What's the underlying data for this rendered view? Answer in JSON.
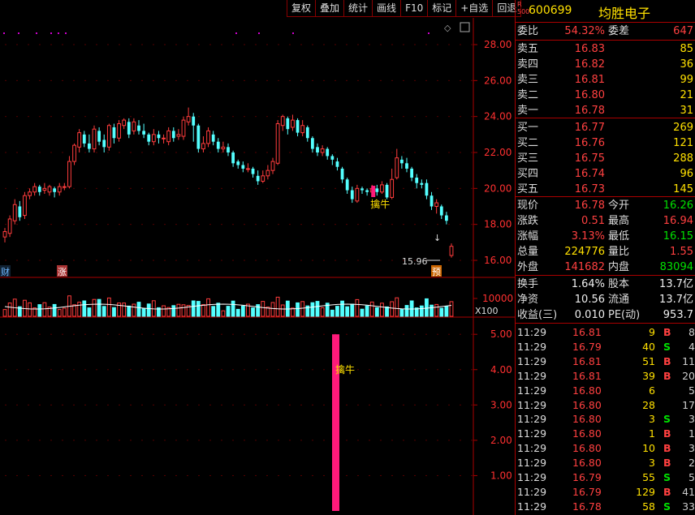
{
  "toolbar": {
    "buttons": [
      "复权",
      "叠加",
      "统计",
      "画线",
      "F10",
      "标记",
      "+自选",
      "回退"
    ]
  },
  "main_chart": {
    "y_ticks": [
      "28.00",
      "26.00",
      "24.00",
      "22.00",
      "20.00",
      "18.00",
      "16.00"
    ],
    "low_annotation": "15.96",
    "signal_label": "擒牛",
    "markers": {
      "cai": "财",
      "zhang": "涨",
      "yu": "预"
    }
  },
  "volume_chart": {
    "y_tick": "10000",
    "unit": "X100"
  },
  "indicator_chart": {
    "y_ticks": [
      "5.00",
      "4.00",
      "3.00",
      "2.00",
      "1.00"
    ],
    "signal_label": "擒牛",
    "bar_value": 5.0
  },
  "colors": {
    "up": "#ff3c3c",
    "down": "#54ffff",
    "signal_bar": "#ff1a7a",
    "axis": "#aa0000"
  },
  "stock": {
    "badge_top": "R",
    "badge_bottom": "500",
    "code": "600699",
    "name": "均胜电子"
  },
  "order_ratio": {
    "label": "委比",
    "value": "54.32%",
    "label2": "委差",
    "value2": "647"
  },
  "asks": [
    {
      "label": "卖五",
      "price": "16.83",
      "vol": "85"
    },
    {
      "label": "卖四",
      "price": "16.82",
      "vol": "36"
    },
    {
      "label": "卖三",
      "price": "16.81",
      "vol": "99"
    },
    {
      "label": "卖二",
      "price": "16.80",
      "vol": "21"
    },
    {
      "label": "卖一",
      "price": "16.78",
      "vol": "31"
    }
  ],
  "bids": [
    {
      "label": "买一",
      "price": "16.77",
      "vol": "269"
    },
    {
      "label": "买二",
      "price": "16.76",
      "vol": "121"
    },
    {
      "label": "买三",
      "price": "16.75",
      "vol": "288"
    },
    {
      "label": "买四",
      "price": "16.74",
      "vol": "96"
    },
    {
      "label": "买五",
      "price": "16.73",
      "vol": "145"
    }
  ],
  "quote": [
    {
      "l1": "现价",
      "v1": "16.78",
      "c1": "red",
      "l2": "今开",
      "v2": "16.26",
      "c2": "green"
    },
    {
      "l1": "涨跌",
      "v1": "0.51",
      "c1": "red",
      "l2": "最高",
      "v2": "16.94",
      "c2": "red"
    },
    {
      "l1": "涨幅",
      "v1": "3.13%",
      "c1": "red",
      "l2": "最低",
      "v2": "16.15",
      "c2": "green"
    },
    {
      "l1": "总量",
      "v1": "224776",
      "c1": "yellow",
      "l2": "量比",
      "v2": "1.55",
      "c2": "red"
    },
    {
      "l1": "外盘",
      "v1": "141682",
      "c1": "red",
      "l2": "内盘",
      "v2": "83094",
      "c2": "green"
    }
  ],
  "fundamentals": [
    {
      "l1": "换手",
      "v1": "1.64%",
      "l2": "股本",
      "v2": "13.7亿"
    },
    {
      "l1": "净资",
      "v1": "10.56",
      "l2": "流通",
      "v2": "13.7亿"
    },
    {
      "l1": "收益(三)",
      "v1": "0.010",
      "l2": "PE(动)",
      "v2": "953.7"
    }
  ],
  "trades": [
    {
      "time": "11:29",
      "price": "16.81",
      "pc": "red",
      "vol": "9",
      "vc": "yellow",
      "side": "B",
      "sc": "red",
      "cnt": "8"
    },
    {
      "time": "11:29",
      "price": "16.79",
      "pc": "red",
      "vol": "40",
      "vc": "yellow",
      "side": "S",
      "sc": "green",
      "cnt": "4"
    },
    {
      "time": "11:29",
      "price": "16.81",
      "pc": "red",
      "vol": "51",
      "vc": "yellow",
      "side": "B",
      "sc": "red",
      "cnt": "11"
    },
    {
      "time": "11:29",
      "price": "16.81",
      "pc": "red",
      "vol": "39",
      "vc": "yellow",
      "side": "B",
      "sc": "red",
      "cnt": "20"
    },
    {
      "time": "11:29",
      "price": "16.80",
      "pc": "red",
      "vol": "6",
      "vc": "yellow",
      "side": "",
      "sc": "red",
      "cnt": "5"
    },
    {
      "time": "11:29",
      "price": "16.80",
      "pc": "red",
      "vol": "28",
      "vc": "yellow",
      "side": "",
      "sc": "red",
      "cnt": "17"
    },
    {
      "time": "11:29",
      "price": "16.80",
      "pc": "red",
      "vol": "3",
      "vc": "yellow",
      "side": "S",
      "sc": "green",
      "cnt": "3"
    },
    {
      "time": "11:29",
      "price": "16.80",
      "pc": "red",
      "vol": "1",
      "vc": "yellow",
      "side": "B",
      "sc": "red",
      "cnt": "1"
    },
    {
      "time": "11:29",
      "price": "16.80",
      "pc": "red",
      "vol": "10",
      "vc": "yellow",
      "side": "B",
      "sc": "red",
      "cnt": "3"
    },
    {
      "time": "11:29",
      "price": "16.80",
      "pc": "red",
      "vol": "3",
      "vc": "yellow",
      "side": "B",
      "sc": "red",
      "cnt": "2"
    },
    {
      "time": "11:29",
      "price": "16.79",
      "pc": "red",
      "vol": "55",
      "vc": "yellow",
      "side": "S",
      "sc": "green",
      "cnt": "5"
    },
    {
      "time": "11:29",
      "price": "16.79",
      "pc": "red",
      "vol": "129",
      "vc": "yellow",
      "side": "B",
      "sc": "red",
      "cnt": "41"
    },
    {
      "time": "11:29",
      "price": "16.78",
      "pc": "red",
      "vol": "58",
      "vc": "yellow",
      "side": "S",
      "sc": "green",
      "cnt": "33"
    }
  ],
  "chart_data": {
    "type": "candlestick",
    "y_range": [
      15.5,
      28.5
    ],
    "candles": [
      [
        17.3,
        17.6,
        17.0,
        17.8
      ],
      [
        17.5,
        18.3,
        17.3,
        18.5
      ],
      [
        18.2,
        19.1,
        18.0,
        19.4
      ],
      [
        19.0,
        18.4,
        18.2,
        19.3
      ],
      [
        18.5,
        19.6,
        18.3,
        19.8
      ],
      [
        19.6,
        19.8,
        19.4,
        20.0
      ],
      [
        19.8,
        20.1,
        19.6,
        20.3
      ],
      [
        20.1,
        19.8,
        19.6,
        20.2
      ],
      [
        19.9,
        20.0,
        19.7,
        20.3
      ],
      [
        19.8,
        20.1,
        19.6,
        20.2
      ],
      [
        20.0,
        19.8,
        19.5,
        20.1
      ],
      [
        19.8,
        20.1,
        19.6,
        20.3
      ],
      [
        20.1,
        20.1,
        19.9,
        20.3
      ],
      [
        20.1,
        21.5,
        20.0,
        21.8
      ],
      [
        21.5,
        22.4,
        21.3,
        22.5
      ],
      [
        22.3,
        23.1,
        22.0,
        23.3
      ],
      [
        23.0,
        22.5,
        22.3,
        23.2
      ],
      [
        22.5,
        22.2,
        22.0,
        23.0
      ],
      [
        22.2,
        23.3,
        22.0,
        23.5
      ],
      [
        23.2,
        22.6,
        22.4,
        23.4
      ],
      [
        22.7,
        22.3,
        22.0,
        23.0
      ],
      [
        22.3,
        23.5,
        22.1,
        23.6
      ],
      [
        23.4,
        22.8,
        22.5,
        23.6
      ],
      [
        22.8,
        23.6,
        22.6,
        23.8
      ],
      [
        23.5,
        23.8,
        23.3,
        23.9
      ],
      [
        23.7,
        23.0,
        22.8,
        23.9
      ],
      [
        23.2,
        23.7,
        23.0,
        23.9
      ],
      [
        23.5,
        23.2,
        23.0,
        23.8
      ],
      [
        23.2,
        23.0,
        22.8,
        23.6
      ],
      [
        23.0,
        22.6,
        22.4,
        23.1
      ],
      [
        22.6,
        23.0,
        22.4,
        23.3
      ],
      [
        23.0,
        22.8,
        22.5,
        23.2
      ],
      [
        22.8,
        22.8,
        22.5,
        23.0
      ],
      [
        22.6,
        23.2,
        22.4,
        23.4
      ],
      [
        23.2,
        22.8,
        22.6,
        23.4
      ],
      [
        22.9,
        23.0,
        22.7,
        23.3
      ],
      [
        22.9,
        23.8,
        22.7,
        24.0
      ],
      [
        23.7,
        24.0,
        23.5,
        24.5
      ],
      [
        24.0,
        23.5,
        22.6,
        24.2
      ],
      [
        23.5,
        22.2,
        22.0,
        23.6
      ],
      [
        22.2,
        22.5,
        22.0,
        22.9
      ],
      [
        22.5,
        23.2,
        22.3,
        23.4
      ],
      [
        23.0,
        22.6,
        22.4,
        23.2
      ],
      [
        22.6,
        22.2,
        22.0,
        22.8
      ],
      [
        22.2,
        22.3,
        22.0,
        22.6
      ],
      [
        22.3,
        22.0,
        21.8,
        22.5
      ],
      [
        22.0,
        21.4,
        21.2,
        22.1
      ],
      [
        21.5,
        21.3,
        21.1,
        21.6
      ],
      [
        21.3,
        21.1,
        20.9,
        21.5
      ],
      [
        21.1,
        21.1,
        20.9,
        21.4
      ],
      [
        21.1,
        20.8,
        20.6,
        21.2
      ],
      [
        20.7,
        20.4,
        20.2,
        21.0
      ],
      [
        20.4,
        20.7,
        20.3,
        21.0
      ],
      [
        20.7,
        21.0,
        20.5,
        21.3
      ],
      [
        21.0,
        21.5,
        20.8,
        21.7
      ],
      [
        21.4,
        23.6,
        21.3,
        23.8
      ],
      [
        23.5,
        24.0,
        23.2,
        24.1
      ],
      [
        23.9,
        23.3,
        23.0,
        24.0
      ],
      [
        23.4,
        23.8,
        23.2,
        24.1
      ],
      [
        23.8,
        23.1,
        22.9,
        23.9
      ],
      [
        23.1,
        23.5,
        22.9,
        23.8
      ],
      [
        23.4,
        22.8,
        22.6,
        23.5
      ],
      [
        22.8,
        22.2,
        22.0,
        22.9
      ],
      [
        22.3,
        22.0,
        21.8,
        22.5
      ],
      [
        22.0,
        22.2,
        21.8,
        22.4
      ],
      [
        22.2,
        21.8,
        21.6,
        22.3
      ],
      [
        21.8,
        21.6,
        21.3,
        21.9
      ],
      [
        21.5,
        21.2,
        21.0,
        21.7
      ],
      [
        21.1,
        20.5,
        20.3,
        21.2
      ],
      [
        20.5,
        19.9,
        19.7,
        20.6
      ],
      [
        19.9,
        19.4,
        19.2,
        20.1
      ],
      [
        19.3,
        20.0,
        19.2,
        20.2
      ],
      [
        20.0,
        19.9,
        19.7,
        20.1
      ],
      [
        19.9,
        19.8,
        19.6,
        20.0
      ],
      [
        19.8,
        20.0,
        19.6,
        20.2
      ],
      [
        20.0,
        19.8,
        19.6,
        20.2
      ],
      [
        19.8,
        20.2,
        19.7,
        20.4
      ],
      [
        20.2,
        19.5,
        19.4,
        20.3
      ],
      [
        19.5,
        20.5,
        19.4,
        21.1
      ],
      [
        20.6,
        21.7,
        20.5,
        22.2
      ],
      [
        21.6,
        21.4,
        21.1,
        21.8
      ],
      [
        21.4,
        21.1,
        20.9,
        21.7
      ],
      [
        21.1,
        20.6,
        20.4,
        21.2
      ],
      [
        20.6,
        20.3,
        20.0,
        20.8
      ],
      [
        20.3,
        20.2,
        20.0,
        20.5
      ],
      [
        20.3,
        19.6,
        19.4,
        20.5
      ],
      [
        19.6,
        19.0,
        18.8,
        19.8
      ],
      [
        19.0,
        19.2,
        18.6,
        19.4
      ],
      [
        19.0,
        18.5,
        18.3,
        19.1
      ],
      [
        18.5,
        18.2,
        18.0,
        18.7
      ],
      [
        16.27,
        16.78,
        16.15,
        16.94
      ]
    ],
    "volume_ylim": [
      0,
      15000
    ],
    "indicator": {
      "bars": [
        {
          "index": 74,
          "value": 5.0
        }
      ],
      "ylim": [
        0,
        5.2
      ]
    }
  }
}
